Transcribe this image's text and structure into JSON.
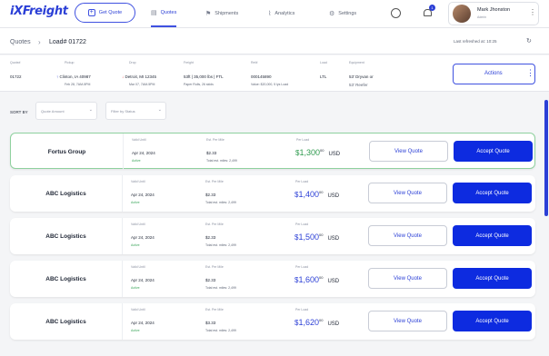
{
  "nav": {
    "logo": "iXFreight",
    "get_quote": "Get Quote",
    "tabs": [
      {
        "label": "Quotes",
        "icon": "document-icon"
      },
      {
        "label": "Shipments",
        "icon": "flag-icon"
      },
      {
        "label": "Analytics",
        "icon": "chart-icon"
      },
      {
        "label": "Settings",
        "icon": "gear-icon"
      }
    ],
    "notification_count": "1",
    "user": {
      "name": "Mark Jhonston",
      "role": "Admin"
    }
  },
  "breadcrumb": {
    "root": "Quotes",
    "current": "Load# 01722"
  },
  "refreshed": "Last refreshed at: 10:25",
  "load": {
    "columns": [
      "Quote#",
      "Pickup",
      "Drop",
      "Freight",
      "Ref#",
      "Load",
      "Equipment"
    ],
    "quote_no": "01722",
    "pickup": "Clinton, IA 40987",
    "pickup_time": "Feb 28, 7AM-5PM",
    "drop": "Detroit, MI 12345",
    "drop_time": "Mar 07, 7AM-5PM",
    "freight": "53ft | 35,000 lbs | FTL",
    "freight_sub": "Paper Rolls, 26 skids",
    "ref": "000145890",
    "ref_sub": "Value: $20,000, 5 lys Load",
    "load_type": "LTL",
    "equipment": "53' Dryvan or",
    "equipment_2": "53' Reefer",
    "actions": "Actions"
  },
  "filters": {
    "sort_label": "SORT BY",
    "sort_placeholder": "Quote Amount",
    "status_placeholder": "Filter by Status"
  },
  "quote_columns": {
    "valid": "Valid Until",
    "est": "Est. Per Mile",
    "per_load": "Per Load"
  },
  "quotes": [
    {
      "carrier": "Fortus Group",
      "valid": "Apr 24, 2024",
      "status": "Active",
      "per_mile": "$2.33",
      "miles": "Total est. miles: 2,499",
      "price_whole": "1,300",
      "price_cents": "00",
      "currency": "USD",
      "view": "View Quote",
      "accept": "Accept Quote"
    },
    {
      "carrier": "ABC Logistics",
      "valid": "Apr 24, 2024",
      "status": "Active",
      "per_mile": "$2.33",
      "miles": "Total est. miles: 2,499",
      "price_whole": "1,400",
      "price_cents": "00",
      "currency": "USD",
      "view": "View Quote",
      "accept": "Accept Quote"
    },
    {
      "carrier": "ABC Logistics",
      "valid": "Apr 24, 2024",
      "status": "Active",
      "per_mile": "$2.33",
      "miles": "Total est. miles: 2,499",
      "price_whole": "1,500",
      "price_cents": "00",
      "currency": "USD",
      "view": "View Quote",
      "accept": "Accept Quote"
    },
    {
      "carrier": "ABC Logistics",
      "valid": "Apr 24, 2024",
      "status": "Active",
      "per_mile": "$2.33",
      "miles": "Total est. miles: 2,499",
      "price_whole": "1,600",
      "price_cents": "00",
      "currency": "USD",
      "view": "View Quote",
      "accept": "Accept Quote"
    },
    {
      "carrier": "ABC Logistics",
      "valid": "Apr 24, 2024",
      "status": "Active",
      "per_mile": "$3.33",
      "miles": "Total est. miles: 2,499",
      "price_whole": "1,620",
      "price_cents": "00",
      "currency": "USD",
      "view": "View Quote",
      "accept": "Accept Quote"
    }
  ]
}
